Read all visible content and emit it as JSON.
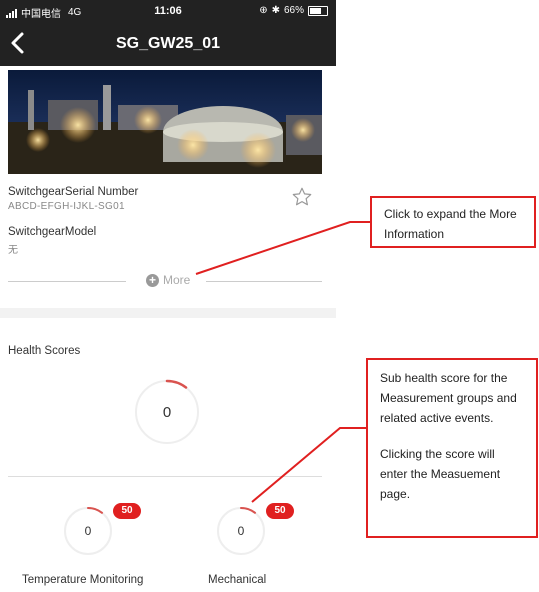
{
  "status_bar": {
    "carrier": "中国电信",
    "network": "4G",
    "time": "11:06",
    "battery": "66%"
  },
  "nav": {
    "title": "SG_GW25_01",
    "back_icon": "chevron-left-icon"
  },
  "switchgear": {
    "serial_label": "SwitchgearSerial Number",
    "serial_value": "ABCD-EFGH-IJKL-SG01",
    "model_label": "SwitchgearModel",
    "model_value": "无",
    "more_label": "More",
    "favorite_icon": "star-outline-icon"
  },
  "health": {
    "title": "Health Scores",
    "overall_score": "0",
    "groups": [
      {
        "label": "Temperature Monitoring",
        "score": "0",
        "events": "50"
      },
      {
        "label": "Mechanical",
        "score": "0",
        "events": "50"
      }
    ]
  },
  "callouts": {
    "more_info": "Click to expand the More Information",
    "sub_scores": "Sub health score for the Measurement groups and related active events.",
    "sub_scores_click": "Clicking the score will enter the Measuement page."
  },
  "colors": {
    "header_bg": "#222222",
    "accent_red": "#e02020",
    "gauge_arc": "#d9534f"
  }
}
